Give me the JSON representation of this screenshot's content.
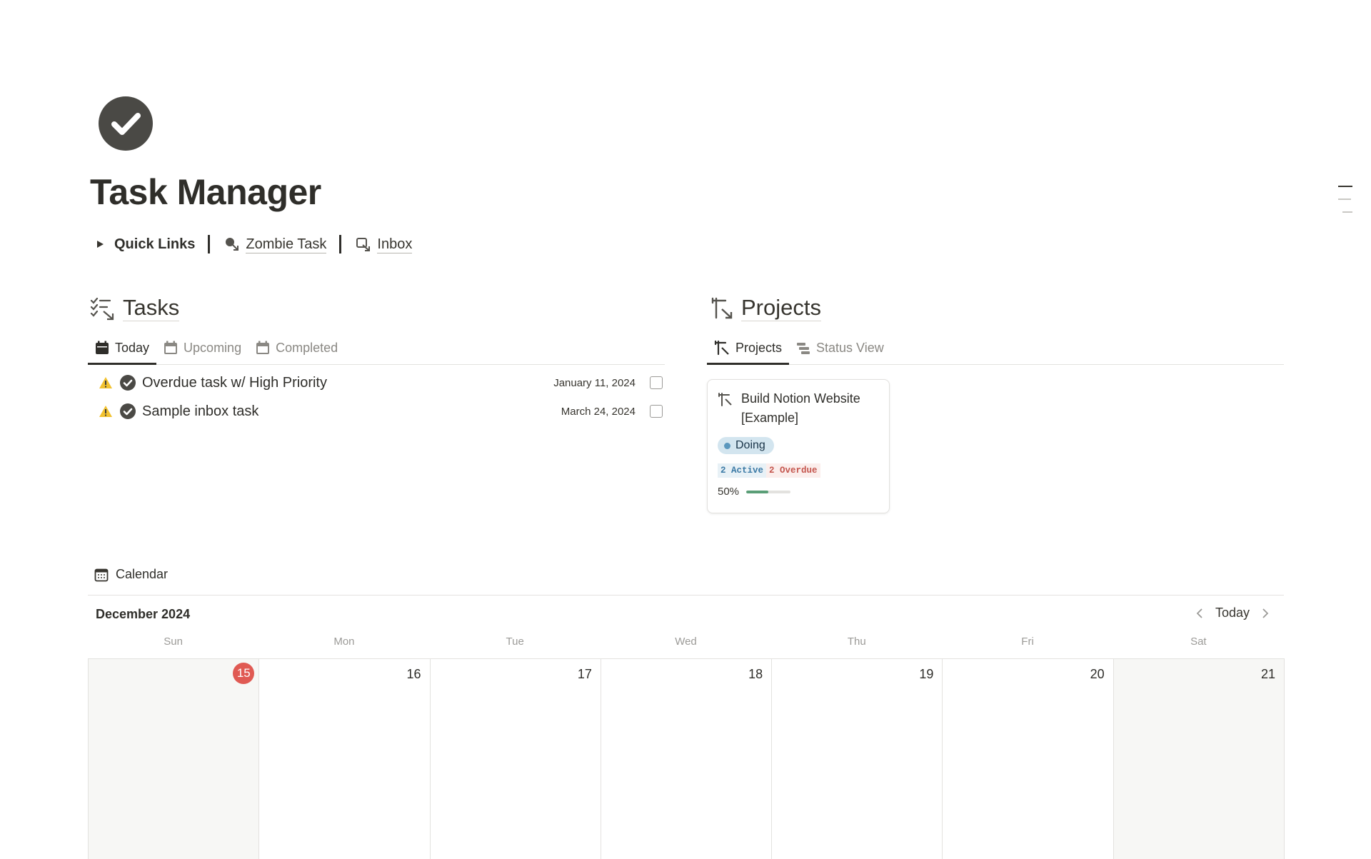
{
  "page": {
    "title": "Task Manager"
  },
  "quick_links": {
    "toggle_label": "Quick Links",
    "separator": "|",
    "links": [
      {
        "label": "Zombie Task"
      },
      {
        "label": "Inbox"
      }
    ]
  },
  "tasks": {
    "title": "Tasks",
    "tabs": [
      {
        "label": "Today",
        "active": true
      },
      {
        "label": "Upcoming",
        "active": false
      },
      {
        "label": "Completed",
        "active": false
      }
    ],
    "rows": [
      {
        "name": "Overdue task w/ High Priority",
        "date": "January 11, 2024",
        "done": false
      },
      {
        "name": "Sample inbox task",
        "date": "March 24, 2024",
        "done": false
      }
    ]
  },
  "projects": {
    "title": "Projects",
    "tabs": [
      {
        "label": "Projects",
        "active": true
      },
      {
        "label": "Status View",
        "active": false
      }
    ],
    "card": {
      "title": "Build Notion Website [Example]",
      "status": "Doing",
      "active_count": "2 Active",
      "overdue_count": "2 Overdue",
      "progress_label": "50%",
      "progress": 0.5
    }
  },
  "calendar": {
    "title": "Calendar",
    "month": "December 2024",
    "today_button": "Today",
    "weekdays": [
      "Sun",
      "Mon",
      "Tue",
      "Wed",
      "Thu",
      "Fri",
      "Sat"
    ],
    "days": [
      "15",
      "16",
      "17",
      "18",
      "19",
      "20",
      "21"
    ],
    "today_index": 0
  },
  "colors": {
    "accent_today": "#e05a53",
    "status_doing_bg": "#d3e5ef",
    "progress_fill": "#5a9e77",
    "overdue_text": "#c4554d",
    "active_text": "#3a79a5"
  }
}
